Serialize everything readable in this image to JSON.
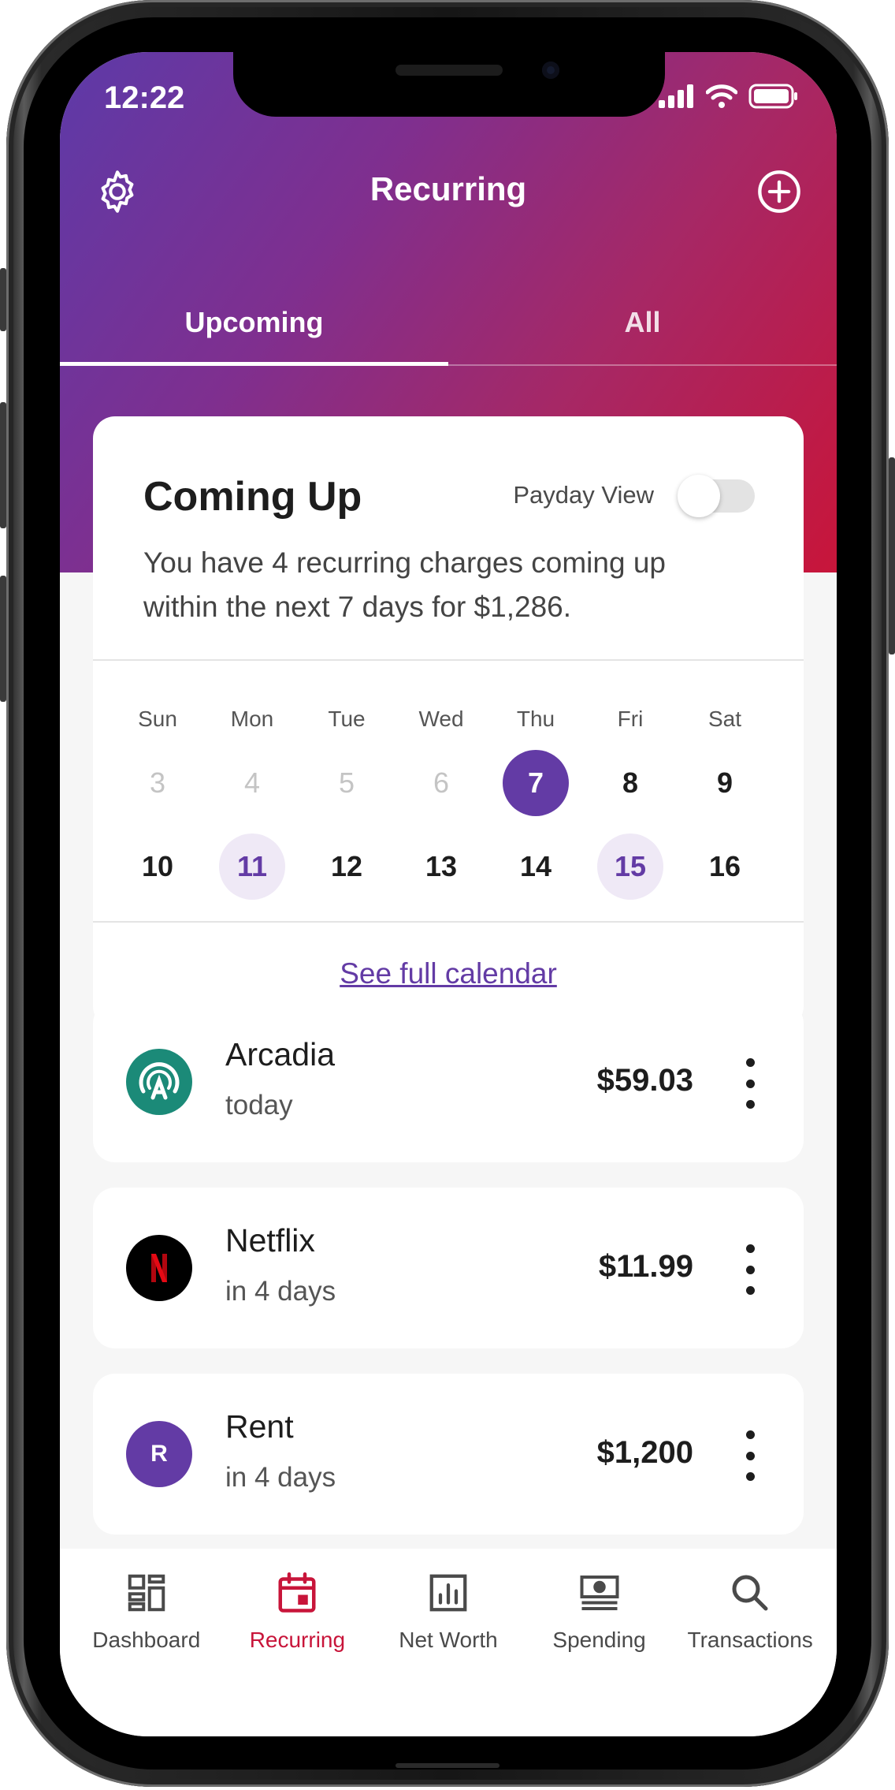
{
  "status_bar": {
    "time": "12:22"
  },
  "header": {
    "title": "Recurring"
  },
  "tabs": [
    {
      "label": "Upcoming"
    },
    {
      "label": "All"
    }
  ],
  "coming_up": {
    "title": "Coming Up",
    "toggle_label": "Payday View",
    "toggle_on": false,
    "description": "You have 4 recurring charges coming up within the next 7 days for $1,286.",
    "weekdays": [
      "Sun",
      "Mon",
      "Tue",
      "Wed",
      "Thu",
      "Fri",
      "Sat"
    ],
    "week1": [
      "3",
      "4",
      "5",
      "6",
      "7",
      "8",
      "9"
    ],
    "week2": [
      "10",
      "11",
      "12",
      "13",
      "14",
      "15",
      "16"
    ],
    "today": "7",
    "marked_days": [
      "11",
      "15"
    ],
    "see_calendar_label": "See full calendar"
  },
  "bills": [
    {
      "name": "Arcadia",
      "due": "today",
      "amount": "$59.03",
      "logo": "arcadia-logo",
      "color": "#1b8a78"
    },
    {
      "name": "Netflix",
      "due": "in 4 days",
      "amount": "$11.99",
      "logo": "netflix-logo",
      "color": "#e50914"
    },
    {
      "name": "Rent",
      "due": "in 4 days",
      "amount": "$1,200",
      "logo": "R",
      "color": "#633ba5"
    }
  ],
  "bottom_nav": [
    {
      "label": "Dashboard",
      "icon": "dashboard-icon"
    },
    {
      "label": "Recurring",
      "icon": "calendar-icon",
      "active": true
    },
    {
      "label": "Net Worth",
      "icon": "bar-chart-icon"
    },
    {
      "label": "Spending",
      "icon": "cash-icon"
    },
    {
      "label": "Transactions",
      "icon": "search-icon"
    }
  ],
  "colors": {
    "accent": "#633ba5",
    "active_nav": "#c8153a",
    "gradient_start": "#5d3aa8",
    "gradient_end": "#c8153a"
  }
}
